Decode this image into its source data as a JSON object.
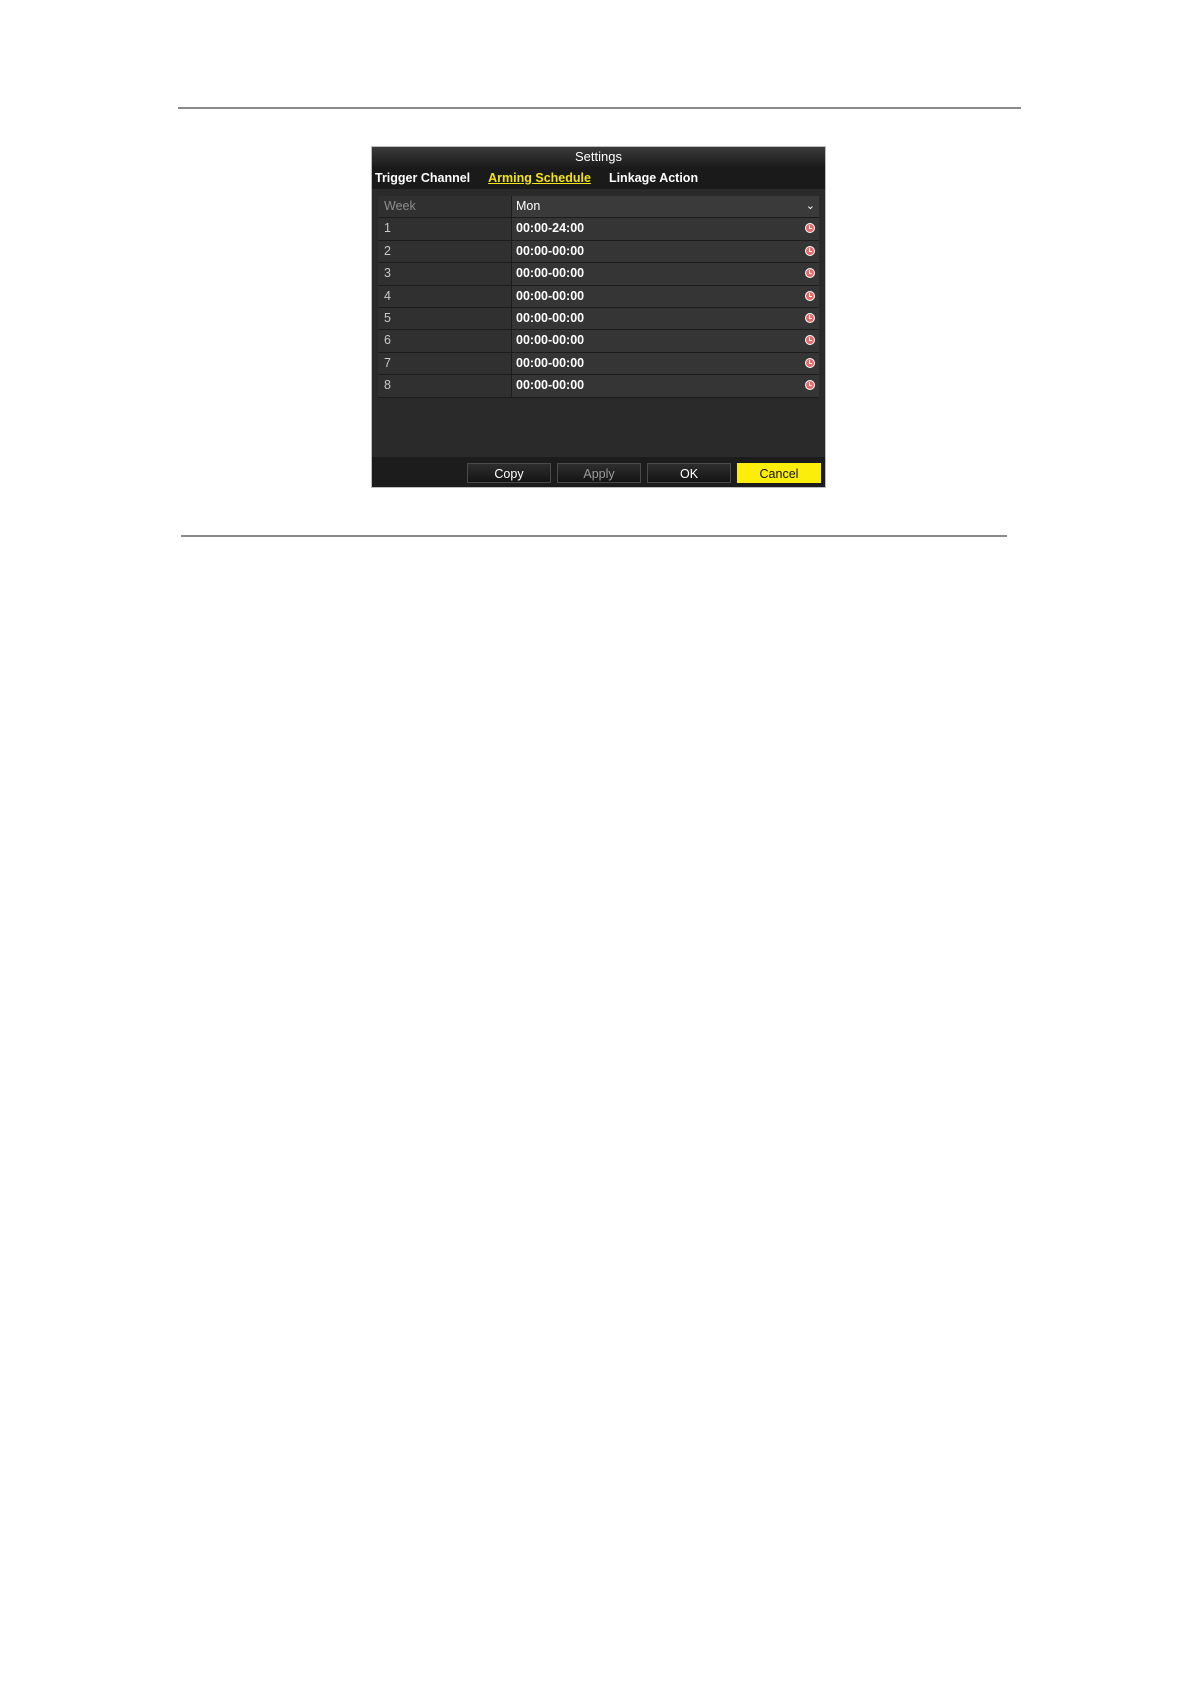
{
  "dialog": {
    "title": "Settings",
    "tabs": [
      {
        "label": "Trigger Channel",
        "active": false
      },
      {
        "label": "Arming Schedule",
        "active": true
      },
      {
        "label": "Linkage Action",
        "active": false
      }
    ]
  },
  "schedule": {
    "week_label": "Week",
    "week_value": "Mon",
    "rows": [
      {
        "index": "1",
        "time": "00:00-24:00"
      },
      {
        "index": "2",
        "time": "00:00-00:00"
      },
      {
        "index": "3",
        "time": "00:00-00:00"
      },
      {
        "index": "4",
        "time": "00:00-00:00"
      },
      {
        "index": "5",
        "time": "00:00-00:00"
      },
      {
        "index": "6",
        "time": "00:00-00:00"
      },
      {
        "index": "7",
        "time": "00:00-00:00"
      },
      {
        "index": "8",
        "time": "00:00-00:00"
      }
    ]
  },
  "buttons": {
    "copy": "Copy",
    "apply": "Apply",
    "ok": "OK",
    "cancel": "Cancel"
  },
  "colors": {
    "accent": "#fcee0a",
    "dialog_bg": "#2a2a2a"
  },
  "icons": {
    "week_dropdown": "chevron-down-icon",
    "time_row": "clock-icon"
  }
}
